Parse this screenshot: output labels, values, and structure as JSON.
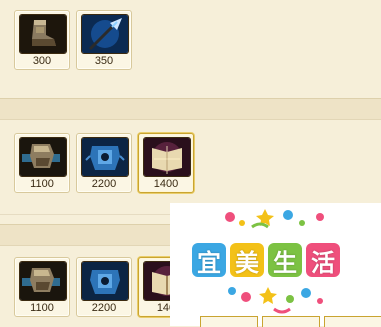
{
  "section1": {
    "items": [
      {
        "icon": "boots-icon",
        "price": "300"
      },
      {
        "icon": "spear-icon",
        "price": "350"
      }
    ]
  },
  "section2": {
    "items": [
      {
        "icon": "gauntlet-icon",
        "price": "1100"
      },
      {
        "icon": "blue-armor-icon",
        "price": "2200"
      },
      {
        "icon": "spellbook-icon",
        "price": "1400"
      }
    ]
  },
  "section3": {
    "items": [
      {
        "icon": "gauntlet-icon",
        "price": "1100"
      },
      {
        "icon": "blue-armor-icon",
        "price": "2200"
      },
      {
        "icon": "spellbook-icon",
        "price": "140"
      }
    ]
  },
  "watermark": {
    "chars": [
      "宜",
      "美",
      "生",
      "活"
    ]
  },
  "colors": {
    "panel_bg": "#f6efd9",
    "band_bg": "#eee3c6",
    "price_text": "#3a2b14",
    "gold_border": "#c9a431",
    "wm_1": "#3ba7e3",
    "wm_2": "#f3c118",
    "wm_3": "#7cc243",
    "wm_4": "#ef4f7c"
  }
}
